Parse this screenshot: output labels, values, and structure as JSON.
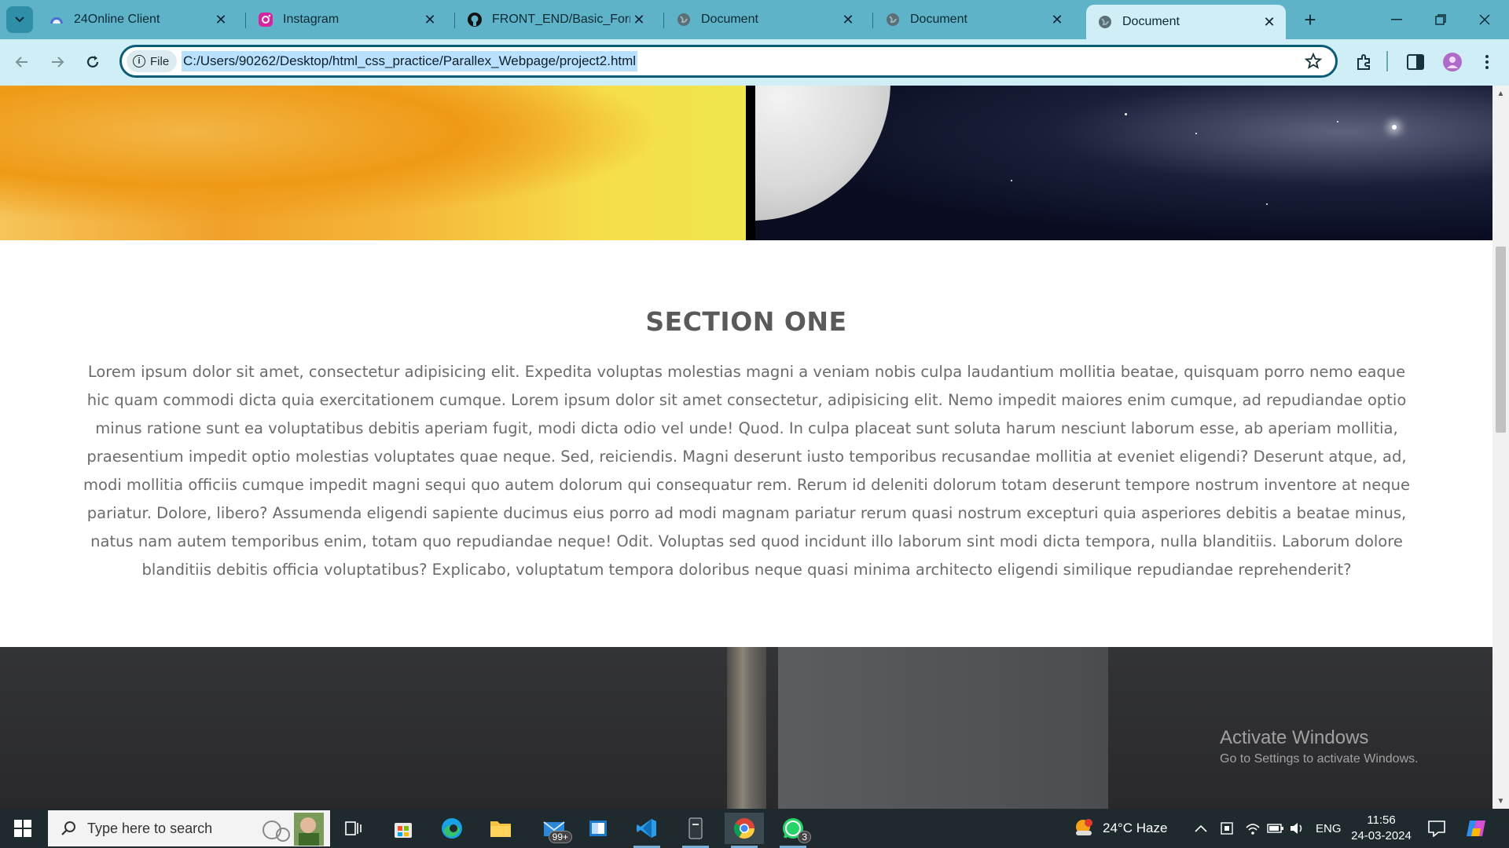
{
  "browser": {
    "tabs": [
      {
        "title": "24Online Client",
        "icon": "cloud-icon",
        "active": false
      },
      {
        "title": "Instagram",
        "icon": "instagram-icon",
        "active": false
      },
      {
        "title": "FRONT_END/Basic_Form/",
        "icon": "github-icon",
        "active": false
      },
      {
        "title": "Document",
        "icon": "globe-icon",
        "active": false
      },
      {
        "title": "Document",
        "icon": "globe-icon",
        "active": false
      },
      {
        "title": "Document",
        "icon": "globe-icon",
        "active": true
      }
    ],
    "new_tab_label": "+",
    "address": {
      "chip_label": "File",
      "url": "C:/Users/90262/Desktop/html_css_practice/Parallex_Webpage/project2.html"
    }
  },
  "page": {
    "section_title": "SECTION ONE",
    "section_text": "Lorem ipsum dolor sit amet, consectetur adipisicing elit. Expedita voluptas molestias magni a veniam nobis culpa laudantium mollitia beatae, quisquam porro nemo eaque hic quam commodi dicta quia exercitationem cumque. Lorem ipsum dolor sit amet consectetur, adipisicing elit. Nemo impedit maiores enim cumque, ad repudiandae optio minus ratione sunt ea voluptatibus debitis aperiam fugit, modi dicta odio vel unde! Quod. In culpa placeat sunt soluta harum nesciunt laborum esse, ab aperiam mollitia, praesentium impedit optio molestias voluptates quae neque. Sed, reiciendis. Magni deserunt iusto temporibus recusandae mollitia at eveniet eligendi? Deserunt atque, ad, modi mollitia officiis cumque impedit magni sequi quo autem dolorum qui consequatur rem. Rerum id deleniti dolorum totam deserunt tempore nostrum inventore at neque pariatur. Dolore, libero? Assumenda eligendi sapiente ducimus eius porro ad modi magnam pariatur rerum quasi nostrum excepturi quia asperiores debitis a beatae minus, natus nam autem temporibus enim, totam quo repudiandae neque! Odit. Voluptas sed quod incidunt illo laborum sint modi dicta tempora, nulla blanditiis. Laborum dolore blanditiis debitis officia voluptatibus? Explicabo, voluptatum tempora doloribus neque quasi minima architecto eligendi similique repudiandae reprehenderit?"
  },
  "watermark": {
    "line1": "Activate Windows",
    "line2": "Go to Settings to activate Windows."
  },
  "taskbar": {
    "search_placeholder": "Type here to search",
    "mail_badge": "99+",
    "whatsapp_badge": "3",
    "weather": "24°C  Haze",
    "language": "ENG",
    "time": "11:56",
    "date": "24-03-2024"
  },
  "colors": {
    "tabbar": "#5fb3c9",
    "toolbar": "#cfeef5",
    "taskbar": "#1f2a2e",
    "heading": "#5a5a5a",
    "body_text": "#6b6b6b"
  }
}
